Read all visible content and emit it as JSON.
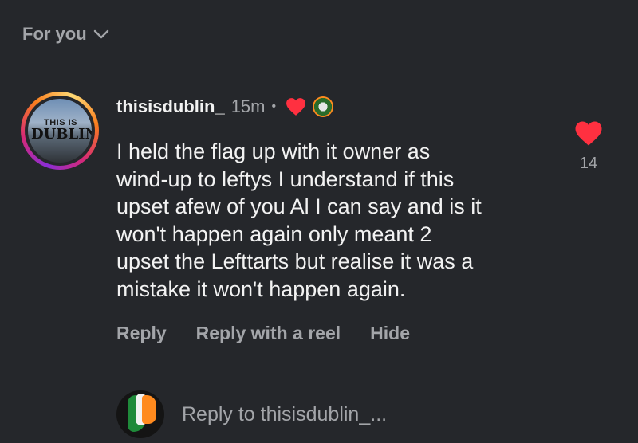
{
  "header": {
    "title": "For you",
    "icon": "chevron-down-icon"
  },
  "comment": {
    "avatar_text_top": "THIS IS",
    "avatar_text_main": "DUBLIN",
    "username": "thisisdublin_",
    "time": "15m",
    "separator": "•",
    "lines": [
      "I held the flag up with it owner as",
      "wind-up to leftys I understand if this",
      "upset afew of you Al I can say and is it",
      "won't happen again only meant 2",
      "upset the Lefttarts but realise it was a",
      "mistake it won't happen again."
    ],
    "like_count": "14",
    "heart_color": "#ff3040"
  },
  "actions": {
    "reply": "Reply",
    "reply_reel": "Reply with a reel",
    "hide": "Hide"
  },
  "reply_input": {
    "placeholder": "Reply to thisisdublin_..."
  }
}
